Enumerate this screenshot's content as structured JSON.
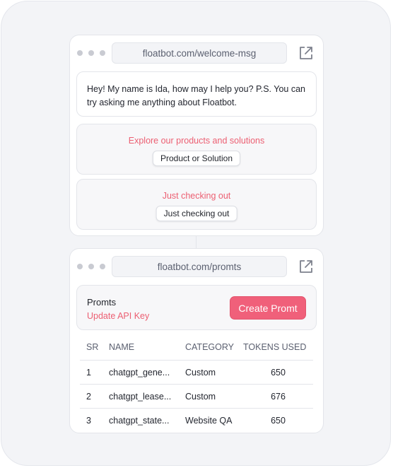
{
  "welcome_card": {
    "url": "floatbot.com/welcome-msg",
    "message": "Hey! My name is Ida, how may I help you? P.S. You can try asking me anything about Floatbot.",
    "options": [
      {
        "title": "Explore our products and solutions",
        "button": "Product or Solution"
      },
      {
        "title": "Just checking out",
        "button": "Just checking out"
      }
    ]
  },
  "prompts_card": {
    "url": "floatbot.com/promts",
    "title": "Promts",
    "link": "Update API Key",
    "create_button": "Create Promt",
    "table": {
      "headers": [
        "SR",
        "NAME",
        "CATEGORY",
        "TOKENS USED"
      ],
      "rows": [
        [
          "1",
          "chatgpt_gene...",
          "Custom",
          "650"
        ],
        [
          "2",
          "chatgpt_lease...",
          "Custom",
          "676"
        ],
        [
          "3",
          "chatgpt_state...",
          "Website QA",
          "650"
        ]
      ]
    }
  },
  "icons": {
    "window_dots": "window-dots-icon",
    "external_link": "external-link-icon"
  },
  "colors": {
    "accent": "#f0607a",
    "accent_text": "#ec5f72",
    "background": "#f3f4f7"
  }
}
